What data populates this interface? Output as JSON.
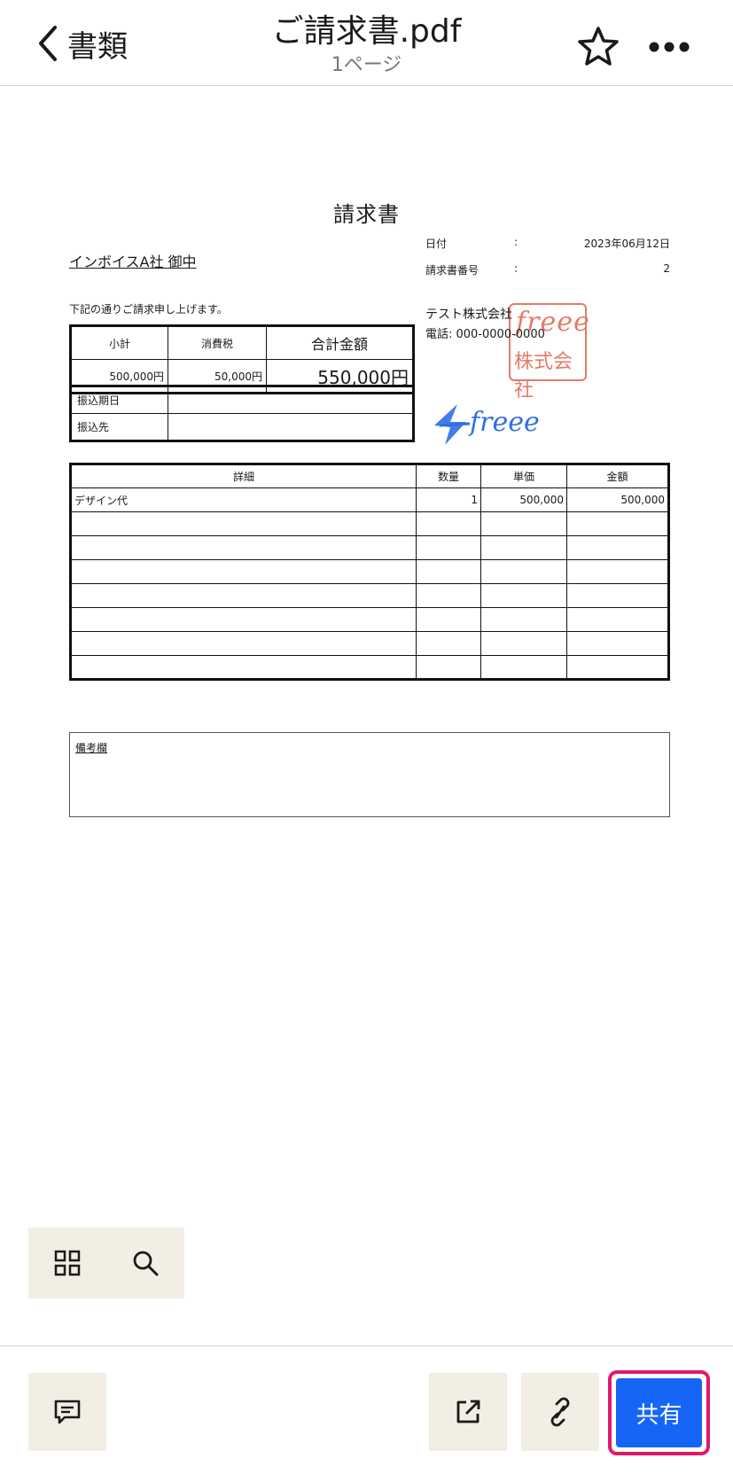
{
  "header": {
    "back_label": "書類",
    "title": "ご請求書.pdf",
    "subtitle": "1ページ"
  },
  "document": {
    "title": "請求書",
    "client": "インボイスA社 御中",
    "intro": "下記の通りご請求申し上げます。",
    "meta": [
      {
        "label": "日付",
        "sep": ":",
        "value": "2023年06月12日"
      },
      {
        "label": "請求書番号",
        "sep": ":",
        "value": "2"
      }
    ],
    "company": "テスト株式会社",
    "phone": "電話: 000-0000-0000",
    "seal": {
      "line1": "freee",
      "line2": "株式会社"
    },
    "logo_text": "freee",
    "summary": {
      "headers": [
        "小計",
        "消費税",
        "合計金額"
      ],
      "values": [
        "500,000円",
        "50,000円",
        "550,000円"
      ]
    },
    "payment": {
      "labels": [
        "振込期日",
        "振込先"
      ],
      "values": [
        "",
        ""
      ]
    },
    "items": {
      "headers": [
        "詳細",
        "数量",
        "単価",
        "金額"
      ],
      "rows": [
        [
          "デザイン代",
          "1",
          "500,000",
          "500,000"
        ],
        [
          "",
          "",
          "",
          ""
        ],
        [
          "",
          "",
          "",
          ""
        ],
        [
          "",
          "",
          "",
          ""
        ],
        [
          "",
          "",
          "",
          ""
        ],
        [
          "",
          "",
          "",
          ""
        ],
        [
          "",
          "",
          "",
          ""
        ],
        [
          "",
          "",
          "",
          ""
        ]
      ]
    },
    "notes_label": "備考欄"
  },
  "bottom": {
    "share_label": "共有"
  },
  "colors": {
    "accent": "#1566f5",
    "highlight": "#e0196a",
    "toolbar_bg": "#f2eee4",
    "seal": "#e0644e",
    "logo": "#2f6fe0"
  }
}
